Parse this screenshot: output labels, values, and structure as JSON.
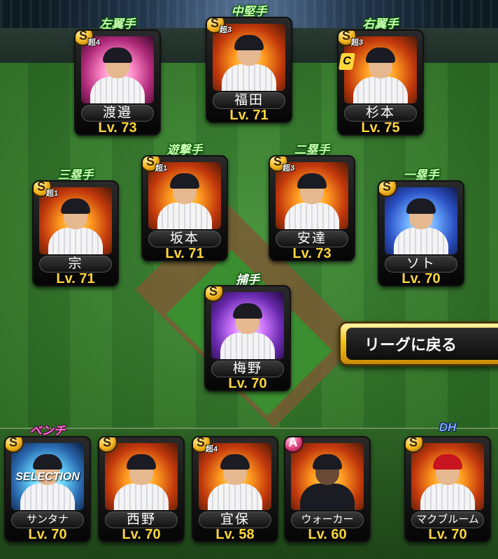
{
  "field": {
    "lf": {
      "position": "左翼手",
      "name": "渡邉",
      "level": "Lv. 73",
      "rank": "S",
      "limit": "超4",
      "bg": "pink"
    },
    "cf": {
      "position": "中堅手",
      "name": "福田",
      "level": "Lv. 71",
      "rank": "S",
      "limit": "超3",
      "bg": "orange"
    },
    "rf": {
      "position": "右翼手",
      "name": "杉本",
      "level": "Lv. 75",
      "rank": "S",
      "limit": "超3",
      "bg": "orange",
      "captain": "C"
    },
    "ss": {
      "position": "遊撃手",
      "name": "坂本",
      "level": "Lv. 71",
      "rank": "S",
      "limit": "超1",
      "bg": "orange"
    },
    "b2": {
      "position": "二塁手",
      "name": "安達",
      "level": "Lv. 73",
      "rank": "S",
      "limit": "超3",
      "bg": "orange"
    },
    "b3": {
      "position": "三塁手",
      "name": "宗",
      "level": "Lv. 71",
      "rank": "S",
      "limit": "超1",
      "bg": "orange"
    },
    "b1": {
      "position": "一塁手",
      "name": "ソト",
      "level": "Lv. 70",
      "rank": "S",
      "limit": "",
      "bg": "blue"
    },
    "c": {
      "position": "捕手",
      "name": "梅野",
      "level": "Lv. 70",
      "rank": "S",
      "limit": "",
      "bg": "purple"
    }
  },
  "bench": {
    "label": "ベンチ",
    "players": [
      {
        "name": "サンタナ",
        "level": "Lv. 70",
        "rank": "S",
        "limit": "",
        "bg": "teal",
        "overlay": "SELECTION"
      },
      {
        "name": "西野",
        "level": "Lv. 70",
        "rank": "S",
        "limit": "",
        "bg": "orange",
        "overlay": ""
      },
      {
        "name": "宜保",
        "level": "Lv. 58",
        "rank": "S",
        "limit": "超4",
        "bg": "orange",
        "overlay": ""
      },
      {
        "name": "ウォーカー",
        "level": "Lv. 60",
        "rank": "A",
        "limit": "",
        "bg": "orange",
        "overlay": ""
      }
    ]
  },
  "dh": {
    "position": "DH",
    "name": "マクブルーム",
    "level": "Lv. 70",
    "rank": "S",
    "limit": "",
    "bg": "orange"
  },
  "actions": {
    "back_label": "リーグに戻る"
  },
  "colors": {
    "level_text": "#ffd63a",
    "button_gold": "#f3c316",
    "position_label": "#ffffff"
  }
}
